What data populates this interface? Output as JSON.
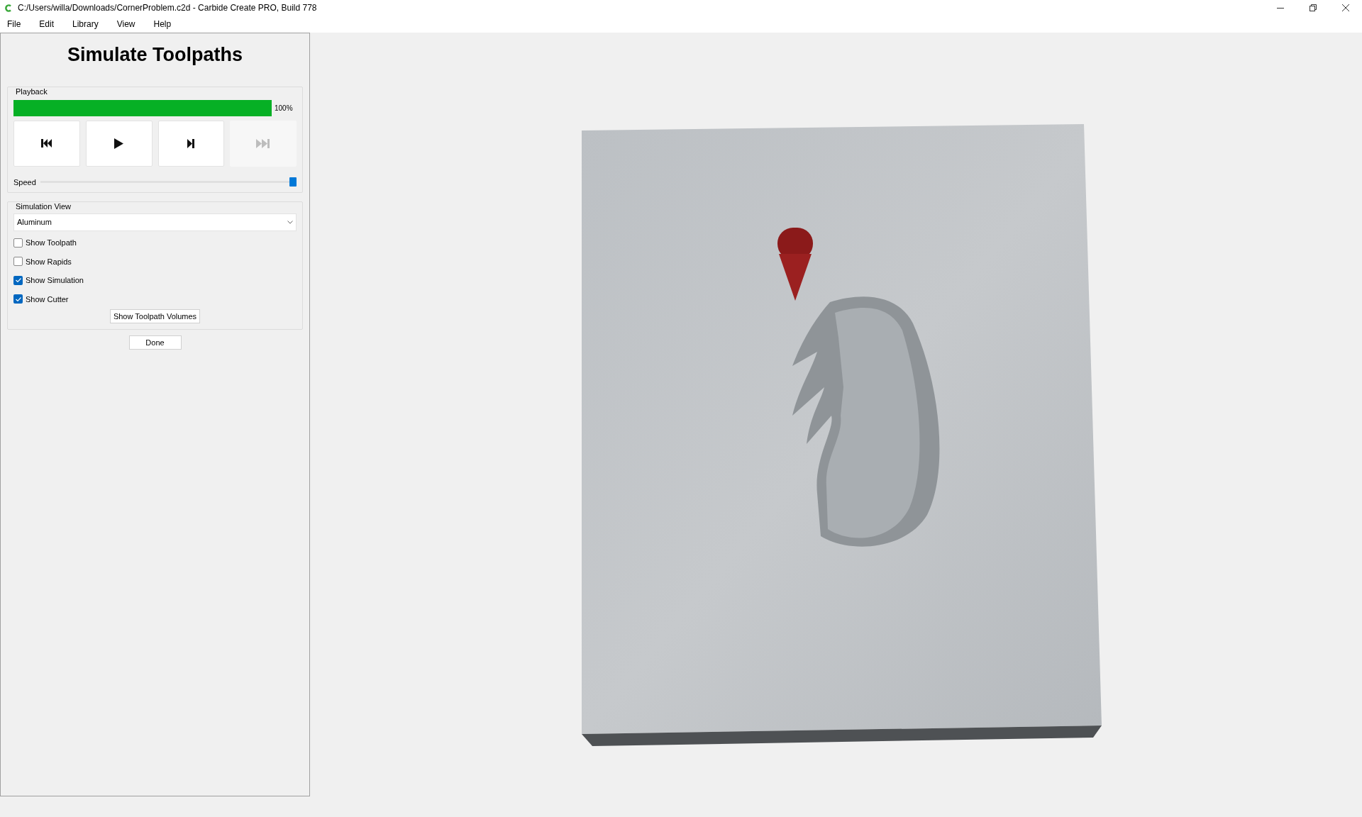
{
  "window": {
    "title": "C:/Users/willa/Downloads/CornerProblem.c2d - Carbide Create PRO, Build 778"
  },
  "menu": [
    {
      "label": "File"
    },
    {
      "label": "Edit"
    },
    {
      "label": "Library"
    },
    {
      "label": "View"
    },
    {
      "label": "Help"
    }
  ],
  "panel": {
    "title": "Simulate Toolpaths",
    "playback": {
      "label": "Playback",
      "progress": {
        "level": 1,
        "reading": "100%"
      },
      "buttons": [
        {
          "kind": "rewind",
          "disabled": false
        },
        {
          "kind": "play",
          "disabled": false
        },
        {
          "kind": "step",
          "disabled": false
        },
        {
          "kind": "end",
          "disabled": true
        }
      ],
      "speed": {
        "label": "Speed",
        "level": 1
      }
    },
    "simulation_view": {
      "label": "Simulation View",
      "material": {
        "value": "Aluminum"
      },
      "options": [
        {
          "label": "Show Toolpath",
          "checked": false
        },
        {
          "label": "Show Rapids",
          "checked": false
        },
        {
          "label": "Show Simulation",
          "checked": true
        },
        {
          "label": "Show Cutter",
          "checked": true
        }
      ],
      "volumes_button": "Show Toolpath Volumes"
    },
    "done_button": "Done"
  }
}
